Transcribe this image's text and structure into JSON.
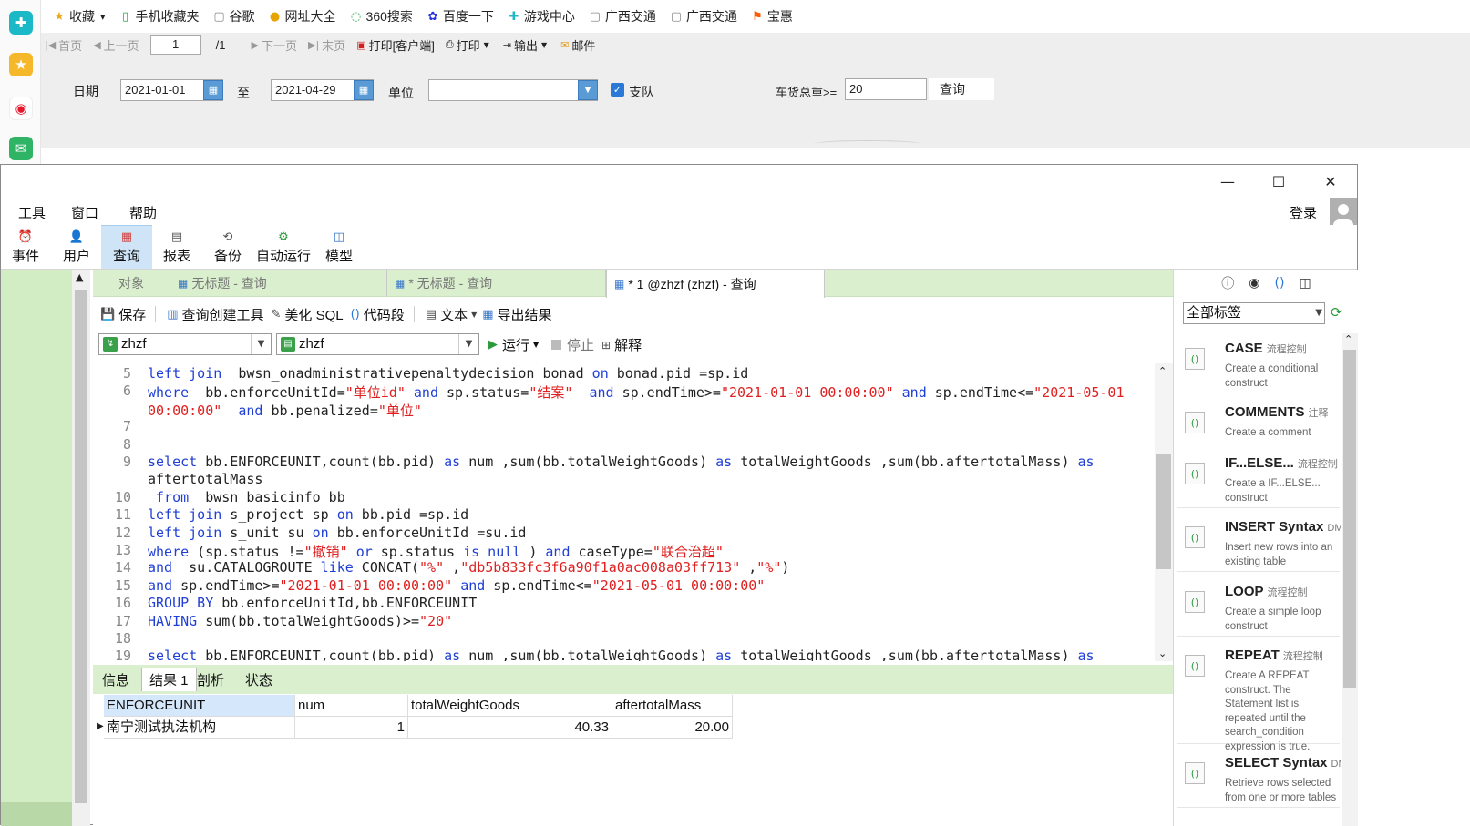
{
  "browser_sidebar": {
    "icons": [
      "plus-app-icon",
      "star-icon",
      "weibo-icon",
      "mail-icon"
    ]
  },
  "bookmarks": [
    {
      "label": "收藏",
      "icon": "star-icon"
    },
    {
      "label": "手机收藏夹",
      "icon": "phone-icon"
    },
    {
      "label": "谷歌",
      "icon": "page-icon"
    },
    {
      "label": "网址大全",
      "icon": "hao-icon"
    },
    {
      "label": "360搜索",
      "icon": "so-icon"
    },
    {
      "label": "百度一下",
      "icon": "baidu-icon"
    },
    {
      "label": "游戏中心",
      "icon": "game-icon"
    },
    {
      "label": "广西交通",
      "icon": "page-icon"
    },
    {
      "label": "广西交通",
      "icon": "page-icon"
    },
    {
      "label": "宝惠",
      "icon": "flag-icon"
    }
  ],
  "report_toolbar": {
    "first": "首页",
    "prev": "上一页",
    "page_value": "1",
    "page_total": "/1",
    "next": "下一页",
    "last": "末页",
    "print_client": "打印[客户端]",
    "print": "打印",
    "export": "输出",
    "mail": "邮件"
  },
  "filter": {
    "date_label": "日期",
    "date_from": "2021-01-01",
    "to_label": "至",
    "date_to": "2021-04-29",
    "unit_label": "单位",
    "unit_value": "",
    "team_label": "支队",
    "team_checked": true,
    "weight_label": "车货总重>=",
    "weight_value": "20",
    "query_label": "查询"
  },
  "app": {
    "menu": [
      "工具",
      "窗口",
      "帮助"
    ],
    "login_label": "登录",
    "ribbon": [
      {
        "label": "事件",
        "icon": "clock-icon"
      },
      {
        "label": "用户",
        "icon": "user-icon"
      },
      {
        "label": "查询",
        "icon": "table-icon",
        "active": true
      },
      {
        "label": "报表",
        "icon": "report-icon"
      },
      {
        "label": "备份",
        "icon": "backup-icon"
      },
      {
        "label": "自动运行",
        "icon": "autorun-icon"
      },
      {
        "label": "模型",
        "icon": "model-icon"
      }
    ],
    "tabs": [
      {
        "label": "对象"
      },
      {
        "label": "无标题 - 查询"
      },
      {
        "label": "* 无标题 - 查询"
      },
      {
        "label": "* 1 @zhzf (zhzf) - 查询",
        "active": true
      }
    ],
    "query_toolbar": {
      "save": "保存",
      "builder": "查询创建工具",
      "beautify": "美化 SQL",
      "snippet": "代码段",
      "text": "文本",
      "export": "导出结果"
    },
    "connection": "zhzf",
    "database": "zhzf",
    "run": "运行",
    "stop": "停止",
    "explain": "解释",
    "editor_lines": [
      {
        "n": "5",
        "t": [
          [
            "kw",
            "left join"
          ],
          [
            "",
            "  bwsn_onadministrativepenaltydecision bonad "
          ],
          [
            "kw",
            "on"
          ],
          [
            "",
            " bonad.pid =sp.id"
          ]
        ]
      },
      {
        "n": "6",
        "t": [
          [
            "kw",
            "where"
          ],
          [
            "",
            "  bb.enforceUnitId="
          ],
          [
            "str",
            "\"单位id\""
          ],
          [
            "",
            " "
          ],
          [
            "kw",
            "and"
          ],
          [
            "",
            " sp.status="
          ],
          [
            "str",
            "\"结案\""
          ],
          [
            "",
            "  "
          ],
          [
            "kw",
            "and"
          ],
          [
            "",
            " sp.endTime>="
          ],
          [
            "str",
            "\"2021-01-01 00:00:00\""
          ],
          [
            "",
            " "
          ],
          [
            "kw",
            "and"
          ],
          [
            "",
            " sp.endTime<="
          ],
          [
            "str",
            "\"2021-05-01"
          ]
        ]
      },
      {
        "n": "",
        "t": [
          [
            "str",
            "00:00:00\""
          ],
          [
            "",
            "  "
          ],
          [
            "kw",
            "and"
          ],
          [
            "",
            " bb.penalized="
          ],
          [
            "str",
            "\"单位\""
          ]
        ]
      },
      {
        "n": "7",
        "t": []
      },
      {
        "n": "8",
        "t": []
      },
      {
        "n": "9",
        "t": [
          [
            "kw",
            "select"
          ],
          [
            "",
            " bb.ENFORCEUNIT,count(bb.pid) "
          ],
          [
            "kw",
            "as"
          ],
          [
            "",
            " num ,sum(bb.totalWeightGoods) "
          ],
          [
            "kw",
            "as"
          ],
          [
            "",
            " totalWeightGoods ,sum(bb.aftertotalMass) "
          ],
          [
            "kw",
            "as"
          ]
        ]
      },
      {
        "n": "",
        "t": [
          [
            "",
            "aftertotalMass"
          ]
        ]
      },
      {
        "n": "10",
        "t": [
          [
            "",
            " "
          ],
          [
            "kw",
            "from"
          ],
          [
            "",
            "  bwsn_basicinfo bb"
          ]
        ]
      },
      {
        "n": "11",
        "t": [
          [
            "kw",
            "left join"
          ],
          [
            "",
            " s_project sp "
          ],
          [
            "kw",
            "on"
          ],
          [
            "",
            " bb.pid =sp.id"
          ]
        ]
      },
      {
        "n": "12",
        "t": [
          [
            "kw",
            "left join"
          ],
          [
            "",
            " s_unit su "
          ],
          [
            "kw",
            "on"
          ],
          [
            "",
            " bb.enforceUnitId =su.id"
          ]
        ]
      },
      {
        "n": "13",
        "t": [
          [
            "kw",
            "where"
          ],
          [
            "",
            " (sp.status !="
          ],
          [
            "str",
            "\"撤销\""
          ],
          [
            "",
            " "
          ],
          [
            "kw",
            "or"
          ],
          [
            "",
            " sp.status "
          ],
          [
            "kw",
            "is null"
          ],
          [
            "",
            " ) "
          ],
          [
            "kw",
            "and"
          ],
          [
            "",
            " caseType="
          ],
          [
            "str",
            "\"联合治超\""
          ]
        ]
      },
      {
        "n": "14",
        "t": [
          [
            "kw",
            "and"
          ],
          [
            "",
            "  su.CATALOGROUTE "
          ],
          [
            "kw",
            "like"
          ],
          [
            "",
            " CONCAT("
          ],
          [
            "str",
            "\"%\""
          ],
          [
            "",
            " ,"
          ],
          [
            "str",
            "\"db5b833fc3f6a90f1a0ac008a03ff713\""
          ],
          [
            "",
            " ,"
          ],
          [
            "str",
            "\"%\""
          ],
          [
            "",
            ")"
          ]
        ]
      },
      {
        "n": "15",
        "t": [
          [
            "kw",
            "and"
          ],
          [
            "",
            " sp.endTime>="
          ],
          [
            "str",
            "\"2021-01-01 00:00:00\""
          ],
          [
            "",
            " "
          ],
          [
            "kw",
            "and"
          ],
          [
            "",
            " sp.endTime<="
          ],
          [
            "str",
            "\"2021-05-01 00:00:00\""
          ]
        ]
      },
      {
        "n": "16",
        "t": [
          [
            "kw",
            "GROUP BY"
          ],
          [
            "",
            " bb.enforceUnitId,bb.ENFORCEUNIT"
          ]
        ]
      },
      {
        "n": "17",
        "t": [
          [
            "kw",
            "HAVING"
          ],
          [
            "",
            " sum(bb.totalWeightGoods)>="
          ],
          [
            "str",
            "\"20\""
          ]
        ]
      },
      {
        "n": "18",
        "t": []
      },
      {
        "n": "19",
        "t": [
          [
            "kw",
            "select"
          ],
          [
            "",
            " bb.ENFORCEUNIT,count(bb.pid) "
          ],
          [
            "kw",
            "as"
          ],
          [
            "",
            " num ,sum(bb.totalWeightGoods) "
          ],
          [
            "kw",
            "as"
          ],
          [
            "",
            " totalWeightGoods ,sum(bb.aftertotalMass) "
          ],
          [
            "kw",
            "as"
          ]
        ]
      }
    ],
    "result_tabs": [
      {
        "label": "信息"
      },
      {
        "label": "结果 1",
        "active": true
      },
      {
        "label": "剖析"
      },
      {
        "label": "状态"
      }
    ],
    "grid": {
      "columns": [
        "ENFORCEUNIT",
        "num",
        "totalWeightGoods",
        "aftertotalMass"
      ],
      "rows": [
        [
          "南宁测试执法机构",
          "1",
          "40.33",
          "20.00"
        ]
      ]
    },
    "right_panel": {
      "tag_filter": "全部标签",
      "snippets": [
        {
          "title": "CASE",
          "tag": "流程控制",
          "desc": "Create a conditional construct"
        },
        {
          "title": "COMMENTS",
          "tag": "注释",
          "desc": "Create a comment"
        },
        {
          "title": "IF...ELSE...",
          "tag": "流程控制",
          "desc": "Create a IF...ELSE... construct"
        },
        {
          "title": "INSERT Syntax",
          "tag": "DM",
          "desc": "Insert new rows into an existing table"
        },
        {
          "title": "LOOP",
          "tag": "流程控制",
          "desc": "Create a simple loop construct"
        },
        {
          "title": "REPEAT",
          "tag": "流程控制",
          "desc": "Create A REPEAT construct. The Statement list is repeated until the search_condition expression is true."
        },
        {
          "title": "SELECT Syntax",
          "tag": "DM",
          "desc": "Retrieve rows selected from one or more tables"
        }
      ]
    }
  }
}
